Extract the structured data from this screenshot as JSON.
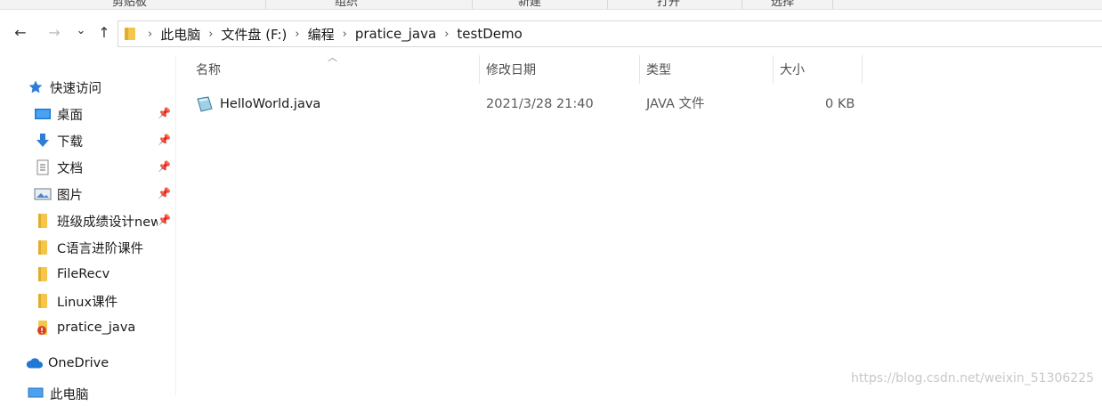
{
  "ribbon": {
    "groups": [
      "剪贴板",
      "组织",
      "新建",
      "打开",
      "选择"
    ]
  },
  "navigation": {
    "back_icon": "←",
    "forward_icon": "→",
    "recent_icon": "⌄",
    "up_icon": "↑",
    "breadcrumb": [
      "此电脑",
      "文件盘 (F:)",
      "编程",
      "pratice_java",
      "testDemo"
    ],
    "separator": "›"
  },
  "sidebar": {
    "quick_access": "快速访问",
    "items": [
      {
        "label": "桌面",
        "icon": "desktop-icon",
        "pinned": true
      },
      {
        "label": "下载",
        "icon": "download-icon",
        "pinned": true
      },
      {
        "label": "文档",
        "icon": "document-icon",
        "pinned": true
      },
      {
        "label": "图片",
        "icon": "pictures-icon",
        "pinned": true
      },
      {
        "label": "班级成绩设计new",
        "icon": "folder-icon",
        "pinned": true
      },
      {
        "label": "C语言进阶课件",
        "icon": "folder-icon",
        "pinned": false
      },
      {
        "label": "FileRecv",
        "icon": "folder-icon",
        "pinned": false
      },
      {
        "label": "Linux课件",
        "icon": "folder-icon",
        "pinned": false
      },
      {
        "label": "pratice_java",
        "icon": "folder-git-icon",
        "pinned": false
      }
    ],
    "onedrive": "OneDrive",
    "this_pc": "此电脑"
  },
  "columns": {
    "name": "名称",
    "modified": "修改日期",
    "type": "类型",
    "size": "大小"
  },
  "files": [
    {
      "name": "HelloWorld.java",
      "modified": "2021/3/28 21:40",
      "type": "JAVA 文件",
      "size": "0 KB"
    }
  ],
  "watermark": "https://blog.csdn.net/weixin_51306225",
  "colors": {
    "folder": "#f4c64c",
    "accent": "#2e7dd7",
    "onedrive": "#1e78d6"
  }
}
